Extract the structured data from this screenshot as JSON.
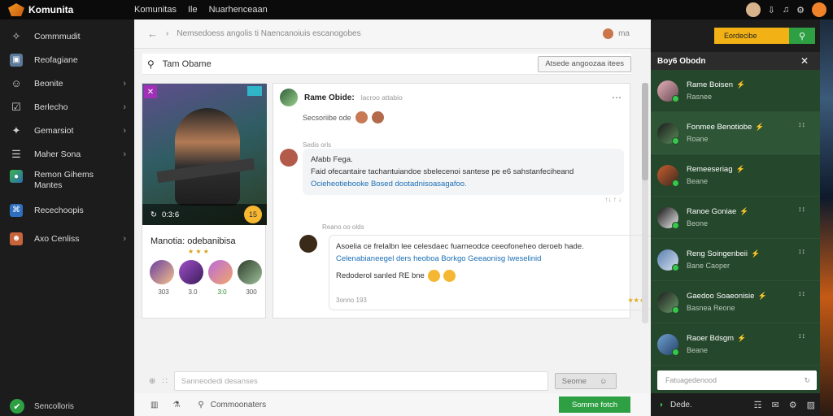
{
  "topbar": {
    "logo": "Komunita",
    "nav": [
      "Komunitas",
      "Ile",
      "Nuarhenceaan"
    ]
  },
  "sidebar": {
    "items": [
      {
        "label": "Commmudit",
        "icon": "bird-icon",
        "chevron": false
      },
      {
        "label": "Reofagiane",
        "icon": "app-icon",
        "chevron": false
      },
      {
        "label": "Beonite",
        "icon": "user-icon",
        "chevron": true
      },
      {
        "label": "Berlecho",
        "icon": "check-icon",
        "chevron": true
      },
      {
        "label": "Gemarsiot",
        "icon": "tag-icon",
        "chevron": true
      },
      {
        "label": "Maher Sona",
        "icon": "notes-icon",
        "chevron": true
      },
      {
        "label": "Remon Gihems",
        "label2": "Mantes",
        "icon": "game-icon",
        "chevron": false
      },
      {
        "label": "Recechoopis",
        "icon": "store-icon",
        "chevron": false
      },
      {
        "label": "Axo Cenliss",
        "icon": "avatar-icon",
        "chevron": true
      }
    ],
    "footer": "Sencolloris"
  },
  "main": {
    "toolbar": {
      "path": "Nemsedoess angolis ti Naencanoiuis escanogobes",
      "right": "ma"
    },
    "search": {
      "value": "Tam Obame",
      "button": "Atsede angoozaa itees"
    },
    "game_card": {
      "bar_time": "0:3:6",
      "level": "15",
      "title": "Manotia: odebanibisa",
      "subtitle": "★ ★ ★",
      "stats": [
        "303",
        "3.0",
        "3:0",
        "300"
      ]
    },
    "post": {
      "author": "Rame Obide:",
      "meta": "lacroo attabio",
      "line": "Secsoriibe ode"
    },
    "comment1": {
      "label": "Sedis orls",
      "text1": "Afabb Fega.",
      "text2": "Faid ofecantaire tachantuiandoe sbelecenoi santese pe e6 sahstanfeciheand",
      "link": "Ocieheotiebooke Bosed dootadnisoasagafoo.",
      "meta": "↑↓ ↑ ↓"
    },
    "comment2": {
      "label": "Reano oo olds",
      "text1": "Asoelia ce frelalbn lee celesdaec fuarneodce ceeofoneheo deroeb hade.",
      "link": "Celenabianeegel ders heoboa Borkgo Geeaonisg Iweselinid",
      "text3": "Redoderol sanled RE bne",
      "meta": "3onno 193",
      "stars": "★★★"
    },
    "compose": {
      "placeholder": "Sanneodedi desanses",
      "send": "Seome"
    },
    "bottom": {
      "label": "Commoonaters",
      "button": "Somme fotch"
    }
  },
  "right_panel": {
    "top_button": "Eordecibe",
    "header": "Boy6 Obodn",
    "friends": [
      {
        "name": "Rame Boisen",
        "status": "Rasnee",
        "right": ""
      },
      {
        "name": "Fonmee Benotiobe",
        "status": "Roane",
        "right": "↕↕"
      },
      {
        "name": "Remeeseriag",
        "status": "Beane",
        "right": ""
      },
      {
        "name": "Ranoe Goniae",
        "status": "Beone",
        "right": "↕↕"
      },
      {
        "name": "Reng Soingenbeii",
        "status": "Bane Caoper",
        "right": "↕↕"
      },
      {
        "name": "Gaedoo Soaeonisie",
        "status": "Basnea Reone",
        "right": "↕↕"
      },
      {
        "name": "Raoer Bdsgm",
        "status": "Beane",
        "right": "↕↕"
      }
    ],
    "search_placeholder": "Fatuagedenood",
    "bottom_label": "Dede."
  }
}
